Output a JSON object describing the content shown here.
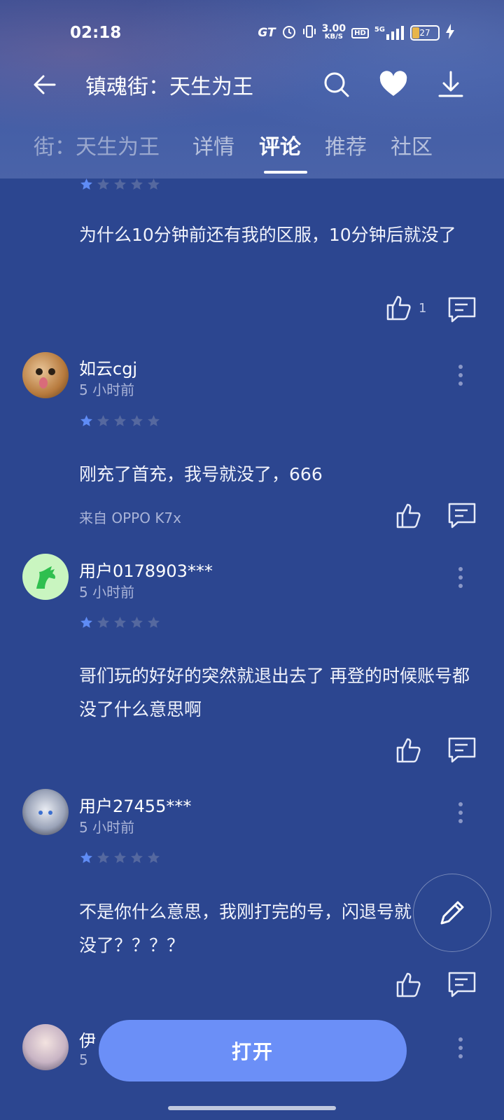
{
  "status_bar": {
    "time": "02:18",
    "gt_label": "GT",
    "speed_value": "3.00",
    "speed_unit": "KB/S",
    "hd_label": "HD",
    "network": "5G",
    "battery": "27"
  },
  "header": {
    "title": "镇魂街：天生为王",
    "tabs": [
      {
        "label": "街：天生为王",
        "active": false
      },
      {
        "label": "详情",
        "active": false
      },
      {
        "label": "评论",
        "active": true
      },
      {
        "label": "推荐",
        "active": false
      },
      {
        "label": "社区",
        "active": false
      }
    ]
  },
  "comments": [
    {
      "rating": 1,
      "text": "为什么10分钟前还有我的区服，10分钟后就没了",
      "likes": "1"
    },
    {
      "username": "如云cgj",
      "time": "5 小时前",
      "rating": 1,
      "text": "刚充了首充，我号就没了，666",
      "device": "来自 OPPO K7x"
    },
    {
      "username": "用户0178903***",
      "time": "5 小时前",
      "rating": 1,
      "text": "哥们玩的好好的突然就退出去了 再登的时候账号都没了什么意思啊"
    },
    {
      "username": "用户27455***",
      "time": "5 小时前",
      "rating": 1,
      "text": "不是你什么意思，我刚打完的号，闪退号就没了？？？？"
    },
    {
      "username": "伊",
      "time": "5"
    }
  ],
  "bottom": {
    "open_label": "打开"
  },
  "colors": {
    "background": "#2c4690",
    "accent": "#6b8ff7",
    "star_active": "#5f8cf5",
    "star_inactive": "#55689f"
  }
}
